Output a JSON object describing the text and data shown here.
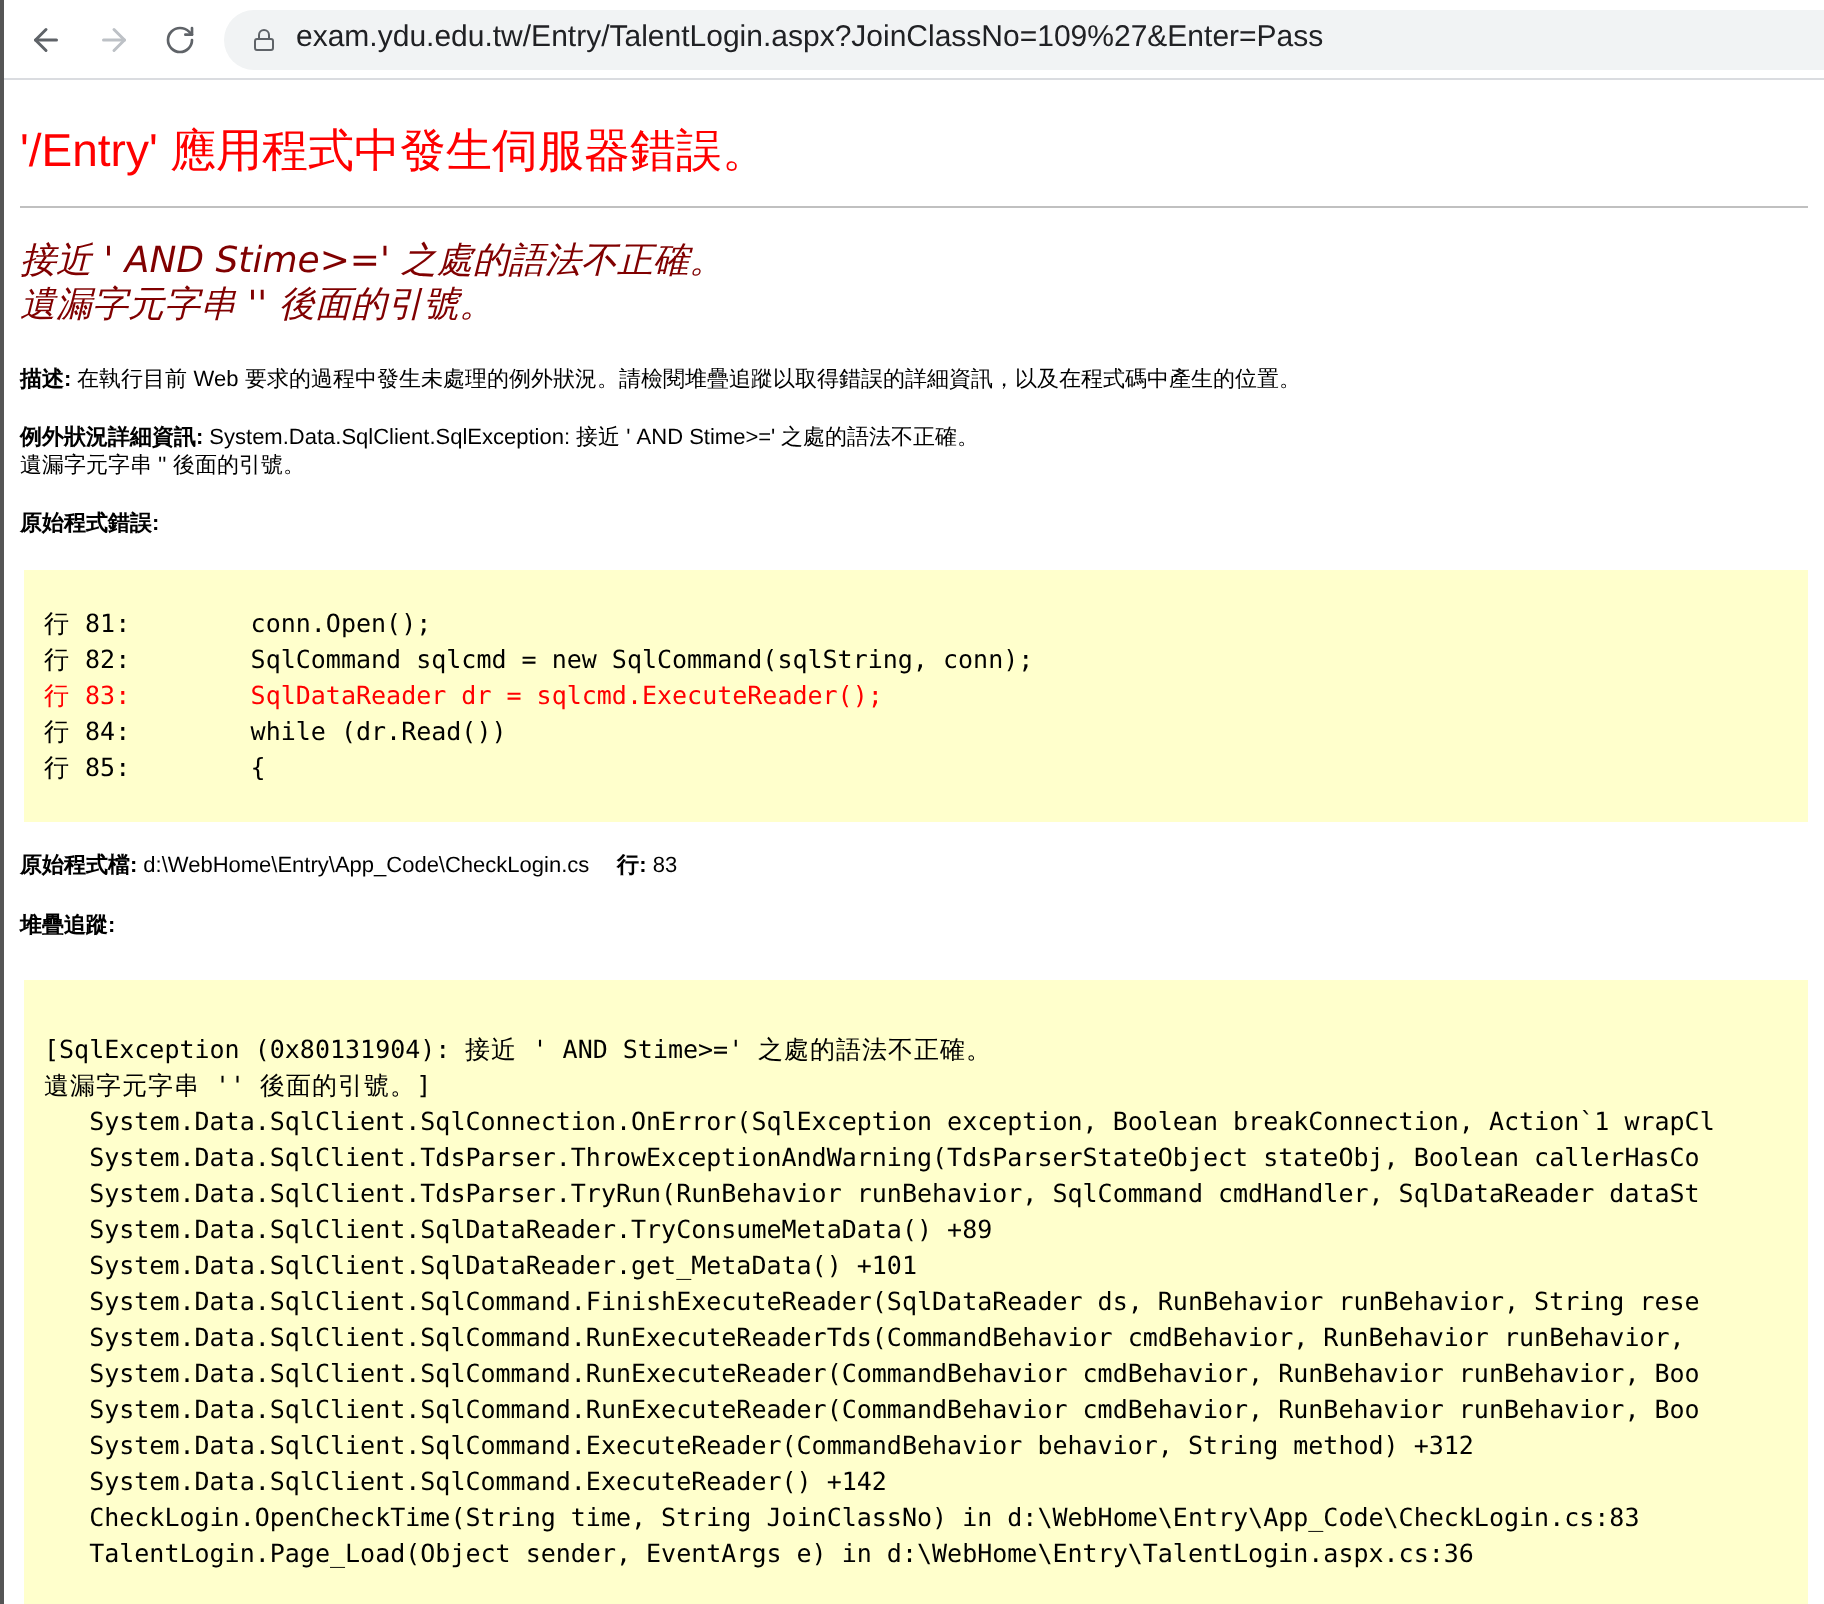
{
  "browser": {
    "url": "exam.ydu.edu.tw/Entry/TalentLogin.aspx?JoinClassNo=109%27&Enter=Pass"
  },
  "title": "'/Entry' 應用程式中發生伺服器錯誤。",
  "error_heading": [
    "接近 ' AND Stime>=' 之處的語法不正確。",
    "遺漏字元字串 '' 後面的引號。"
  ],
  "description": {
    "label": "描述:",
    "text": "在執行目前 Web 要求的過程中發生未處理的例外狀況。請檢閱堆疊追蹤以取得錯誤的詳細資訊，以及在程式碼中產生的位置。"
  },
  "exception_details": {
    "label": "例外狀況詳細資訊:",
    "lines": [
      "System.Data.SqlClient.SqlException: 接近 ' AND Stime>=' 之處的語法不正確。",
      "遺漏字元字串 '' 後面的引號。"
    ]
  },
  "source_error": {
    "label": "原始程式錯誤:",
    "lines": [
      {
        "number": "行 81:",
        "code": "        conn.Open();",
        "highlighted": false
      },
      {
        "number": "行 82:",
        "code": "        SqlCommand sqlcmd = new SqlCommand(sqlString, conn);",
        "highlighted": false
      },
      {
        "number": "行 83:",
        "code": "        SqlDataReader dr = sqlcmd.ExecuteReader();",
        "highlighted": true
      },
      {
        "number": "行 84:",
        "code": "        while (dr.Read())",
        "highlighted": false
      },
      {
        "number": "行 85:",
        "code": "        {",
        "highlighted": false
      }
    ]
  },
  "source_file": {
    "label": "原始程式檔:",
    "path": "d:\\WebHome\\Entry\\App_Code\\CheckLogin.cs",
    "line_label": "行:",
    "line": "83"
  },
  "stack_trace": {
    "label": "堆疊追蹤:",
    "lines": [
      "[SqlException (0x80131904): 接近 ' AND Stime>=' 之處的語法不正確。",
      "遺漏字元字串 '' 後面的引號。]",
      "   System.Data.SqlClient.SqlConnection.OnError(SqlException exception, Boolean breakConnection, Action`1 wrapCl",
      "   System.Data.SqlClient.TdsParser.ThrowExceptionAndWarning(TdsParserStateObject stateObj, Boolean callerHasCo",
      "   System.Data.SqlClient.TdsParser.TryRun(RunBehavior runBehavior, SqlCommand cmdHandler, SqlDataReader dataSt",
      "   System.Data.SqlClient.SqlDataReader.TryConsumeMetaData() +89",
      "   System.Data.SqlClient.SqlDataReader.get_MetaData() +101",
      "   System.Data.SqlClient.SqlCommand.FinishExecuteReader(SqlDataReader ds, RunBehavior runBehavior, String rese",
      "   System.Data.SqlClient.SqlCommand.RunExecuteReaderTds(CommandBehavior cmdBehavior, RunBehavior runBehavior,",
      "   System.Data.SqlClient.SqlCommand.RunExecuteReader(CommandBehavior cmdBehavior, RunBehavior runBehavior, Boo",
      "   System.Data.SqlClient.SqlCommand.RunExecuteReader(CommandBehavior cmdBehavior, RunBehavior runBehavior, Boo",
      "   System.Data.SqlClient.SqlCommand.ExecuteReader(CommandBehavior behavior, String method) +312",
      "   System.Data.SqlClient.SqlCommand.ExecuteReader() +142",
      "   CheckLogin.OpenCheckTime(String time, String JoinClassNo) in d:\\WebHome\\Entry\\App_Code\\CheckLogin.cs:83",
      "   TalentLogin.Page_Load(Object sender, EventArgs e) in d:\\WebHome\\Entry\\TalentLogin.aspx.cs:36"
    ]
  }
}
